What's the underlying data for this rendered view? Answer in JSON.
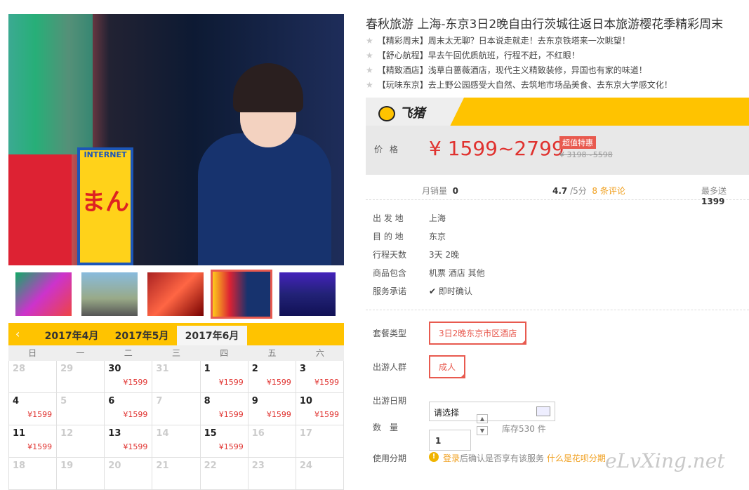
{
  "product": {
    "title": "春秋旅游 上海-东京3日2晚自由行茨城往返日本旅游樱花季精彩周末",
    "features": [
      "【精彩周末】周末太无聊？日本说走就走！去东京铁塔来一次眺望！",
      "【舒心航程】早去午回优质航班，行程不赶，不红眼！",
      "【精致酒店】浅草白蔷薇酒店，现代主义精致装修，异国也有家的味道！",
      "【玩味东京】去上野公园感受大自然、去筑地市场品美食、去东京大学感文化！"
    ]
  },
  "brand": {
    "name": "飞猪"
  },
  "price": {
    "label": "价格",
    "value": "¥ 1599~2799",
    "badge": "超值特惠",
    "old": "¥ 3198~5598"
  },
  "stats": {
    "monthly_label": "月销量",
    "monthly": "0",
    "rating": "4.7",
    "rating_suffix": "/5分",
    "reviews": "8 条评论",
    "points_label": "最多送",
    "points": "1399"
  },
  "info": [
    {
      "label": "出 发 地",
      "value": "上海"
    },
    {
      "label": "目 的 地",
      "value": "东京"
    },
    {
      "label": "行程天数",
      "value": "3天 2晚"
    },
    {
      "label": "商品包含",
      "value": "机票   酒店   其他"
    },
    {
      "label": "服务承诺",
      "value": "即时确认"
    }
  ],
  "options": {
    "package_label": "套餐类型",
    "package": "3日2晚东京市区酒店",
    "people_label": "出游人群",
    "people": "成人",
    "date_label": "出游日期",
    "date_placeholder": "请选择",
    "qty_label": "数　量",
    "qty": "1",
    "stock": "库存530 件",
    "install_label": "使用分期",
    "install_login": "登录",
    "install_text": "后确认是否享有该服务",
    "install_link": "什么是花呗分期"
  },
  "calendar": {
    "prev": "‹",
    "months": [
      "2017年4月",
      "2017年5月",
      "2017年6月"
    ],
    "weekdays": [
      "日",
      "一",
      "二",
      "三",
      "四",
      "五",
      "六"
    ],
    "rows": [
      [
        {
          "d": "28",
          "g": true
        },
        {
          "d": "29",
          "g": true
        },
        {
          "d": "30",
          "p": "¥1599"
        },
        {
          "d": "31",
          "g": true
        },
        {
          "d": "1",
          "p": "¥1599"
        },
        {
          "d": "2",
          "p": "¥1599"
        },
        {
          "d": "3",
          "p": "¥1599"
        }
      ],
      [
        {
          "d": "4",
          "p": "¥1599"
        },
        {
          "d": "5",
          "g": true
        },
        {
          "d": "6",
          "p": "¥1599"
        },
        {
          "d": "7",
          "g": true
        },
        {
          "d": "8",
          "p": "¥1599"
        },
        {
          "d": "9",
          "p": "¥1599"
        },
        {
          "d": "10",
          "p": "¥1599"
        }
      ],
      [
        {
          "d": "11",
          "p": "¥1599"
        },
        {
          "d": "12",
          "g": true
        },
        {
          "d": "13",
          "p": "¥1599"
        },
        {
          "d": "14",
          "g": true
        },
        {
          "d": "15",
          "p": "¥1599"
        },
        {
          "d": "16",
          "g": true
        },
        {
          "d": "17",
          "g": true
        }
      ],
      [
        {
          "d": "18",
          "g": true
        },
        {
          "d": "19",
          "g": true
        },
        {
          "d": "20",
          "g": true
        },
        {
          "d": "21",
          "g": true
        },
        {
          "d": "22",
          "g": true
        },
        {
          "d": "23",
          "g": true
        },
        {
          "d": "24",
          "g": true
        }
      ]
    ]
  },
  "image": {
    "sign1": "INTERNET",
    "sign2": "まん"
  },
  "watermark": "eLvXing.net"
}
